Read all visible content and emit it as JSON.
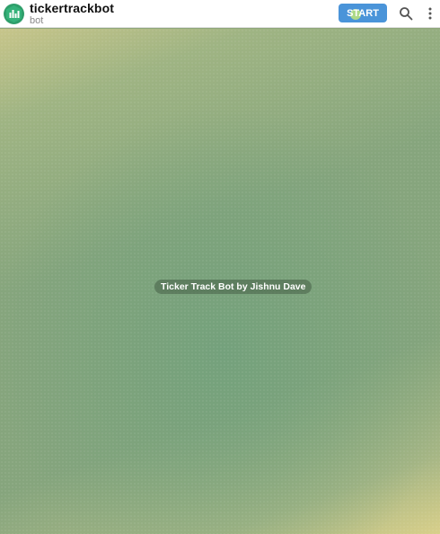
{
  "header": {
    "bot_name": "tickertrackbot",
    "bot_status": "bot",
    "avatar_icon": "chart-bars-icon",
    "avatar_color": "#2e9e6a",
    "start_label": "START",
    "start_color": "#4a94d9",
    "search_icon": "search-icon",
    "menu_icon": "more-vert-icon"
  },
  "chat": {
    "service_message": "Ticker Track Bot by Jishnu Dave",
    "background_colors": [
      "#86a57d",
      "#74a17c",
      "#d8cf8a"
    ]
  }
}
